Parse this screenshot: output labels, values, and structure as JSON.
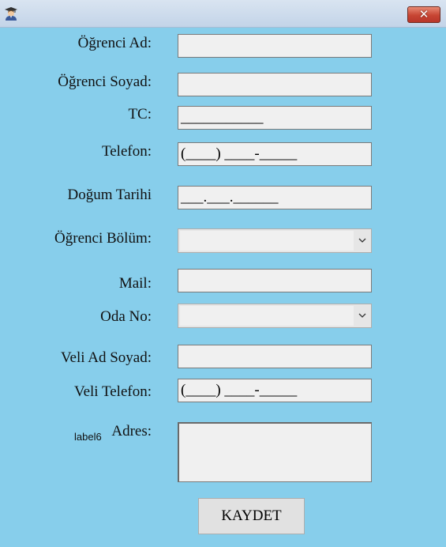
{
  "window": {
    "close_glyph": "✕",
    "icon": "student-graduate-icon"
  },
  "form": {
    "first_name": {
      "label": "Öğrenci Ad:",
      "value": ""
    },
    "last_name": {
      "label": "Öğrenci Soyad:",
      "value": ""
    },
    "tc": {
      "label": "TC:",
      "value": "___________"
    },
    "phone": {
      "label": "Telefon:",
      "value": "(____) ____-_____"
    },
    "birth_date": {
      "label": "Doğum Tarihi",
      "value": "___.___.______"
    },
    "department": {
      "label": "Öğrenci Bölüm:",
      "value": ""
    },
    "mail": {
      "label": "Mail:",
      "value": ""
    },
    "room": {
      "label": "Oda No:",
      "value": ""
    },
    "parent_name": {
      "label": "Veli Ad Soyad:",
      "value": ""
    },
    "parent_phone": {
      "label": "Veli Telefon:",
      "value": "(____) ____-_____"
    },
    "address": {
      "label": "Adres:",
      "value": "",
      "extra_label": "label6"
    },
    "save_label": "KAYDET"
  },
  "colors": {
    "background": "#87CEEB",
    "field": "#f0f0f0",
    "close": "#c74533"
  }
}
